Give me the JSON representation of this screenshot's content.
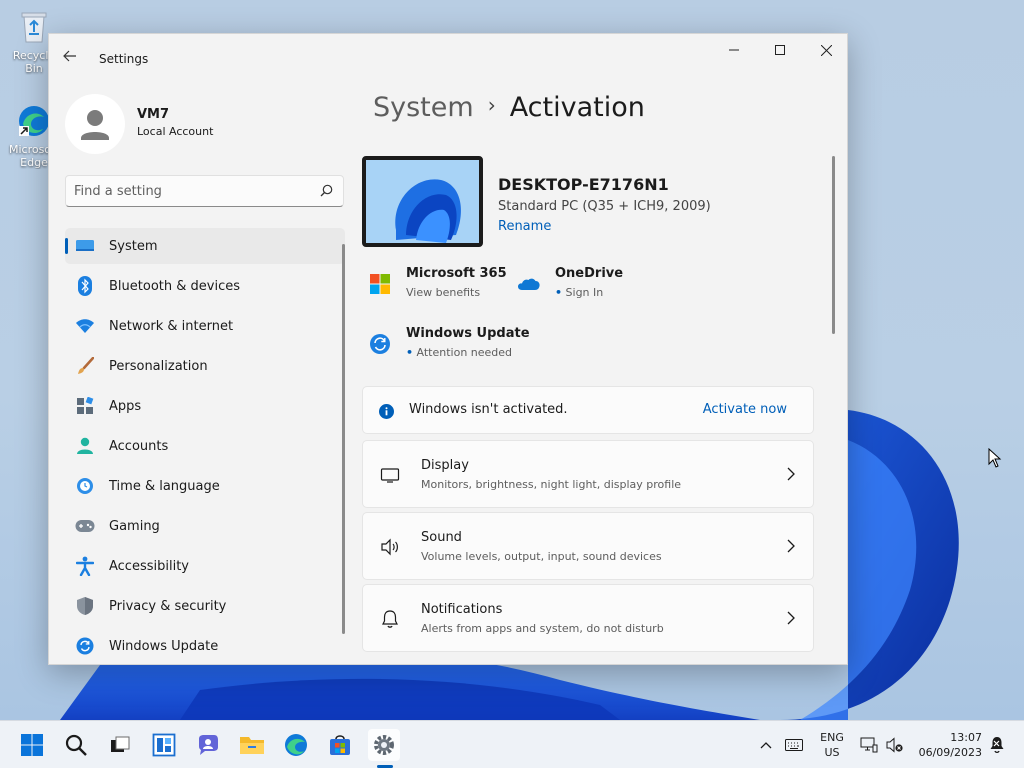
{
  "desktop": {
    "icons": [
      {
        "name": "recycle-bin",
        "label": "Recycle Bin"
      },
      {
        "name": "microsoft-edge",
        "label": "Microsoft Edge"
      }
    ]
  },
  "window": {
    "title": "Settings",
    "profile": {
      "name": "VM7",
      "account_type": "Local Account"
    },
    "search": {
      "placeholder": "Find a setting"
    },
    "nav": [
      {
        "label": "System",
        "icon": "system-icon",
        "active": true
      },
      {
        "label": "Bluetooth & devices",
        "icon": "bluetooth-icon"
      },
      {
        "label": "Network & internet",
        "icon": "wifi-icon"
      },
      {
        "label": "Personalization",
        "icon": "brush-icon"
      },
      {
        "label": "Apps",
        "icon": "apps-icon"
      },
      {
        "label": "Accounts",
        "icon": "person-icon"
      },
      {
        "label": "Time & language",
        "icon": "globe-clock-icon"
      },
      {
        "label": "Gaming",
        "icon": "gamepad-icon"
      },
      {
        "label": "Accessibility",
        "icon": "accessibility-icon"
      },
      {
        "label": "Privacy & security",
        "icon": "shield-icon"
      },
      {
        "label": "Windows Update",
        "icon": "update-icon"
      }
    ]
  },
  "main": {
    "breadcrumb": {
      "parent": "System",
      "current": "Activation"
    },
    "device": {
      "name": "DESKTOP-E7176N1",
      "model": "Standard PC (Q35 + ICH9, 2009)",
      "rename_label": "Rename"
    },
    "quick_links": {
      "m365": {
        "title": "Microsoft 365",
        "subtitle": "View benefits"
      },
      "onedrive": {
        "title": "OneDrive",
        "dot": "•",
        "subtitle": "Sign In"
      },
      "update": {
        "title": "Windows Update",
        "dot": "•",
        "subtitle": "Attention needed"
      }
    },
    "banner": {
      "message": "Windows isn't activated.",
      "action": "Activate now"
    },
    "settings_rows": [
      {
        "title": "Display",
        "subtitle": "Monitors, brightness, night light, display profile",
        "icon": "monitor-icon"
      },
      {
        "title": "Sound",
        "subtitle": "Volume levels, output, input, sound devices",
        "icon": "speaker-icon"
      },
      {
        "title": "Notifications",
        "subtitle": "Alerts from apps and system, do not disturb",
        "icon": "bell-icon"
      }
    ]
  },
  "taskbar": {
    "apps": [
      "start",
      "search",
      "task-view",
      "widgets",
      "teams-chat",
      "file-explorer",
      "edge",
      "store",
      "settings"
    ],
    "active_app": "settings",
    "language": {
      "line1": "ENG",
      "line2": "US"
    },
    "clock": {
      "time": "13:07",
      "date": "06/09/2023"
    }
  }
}
